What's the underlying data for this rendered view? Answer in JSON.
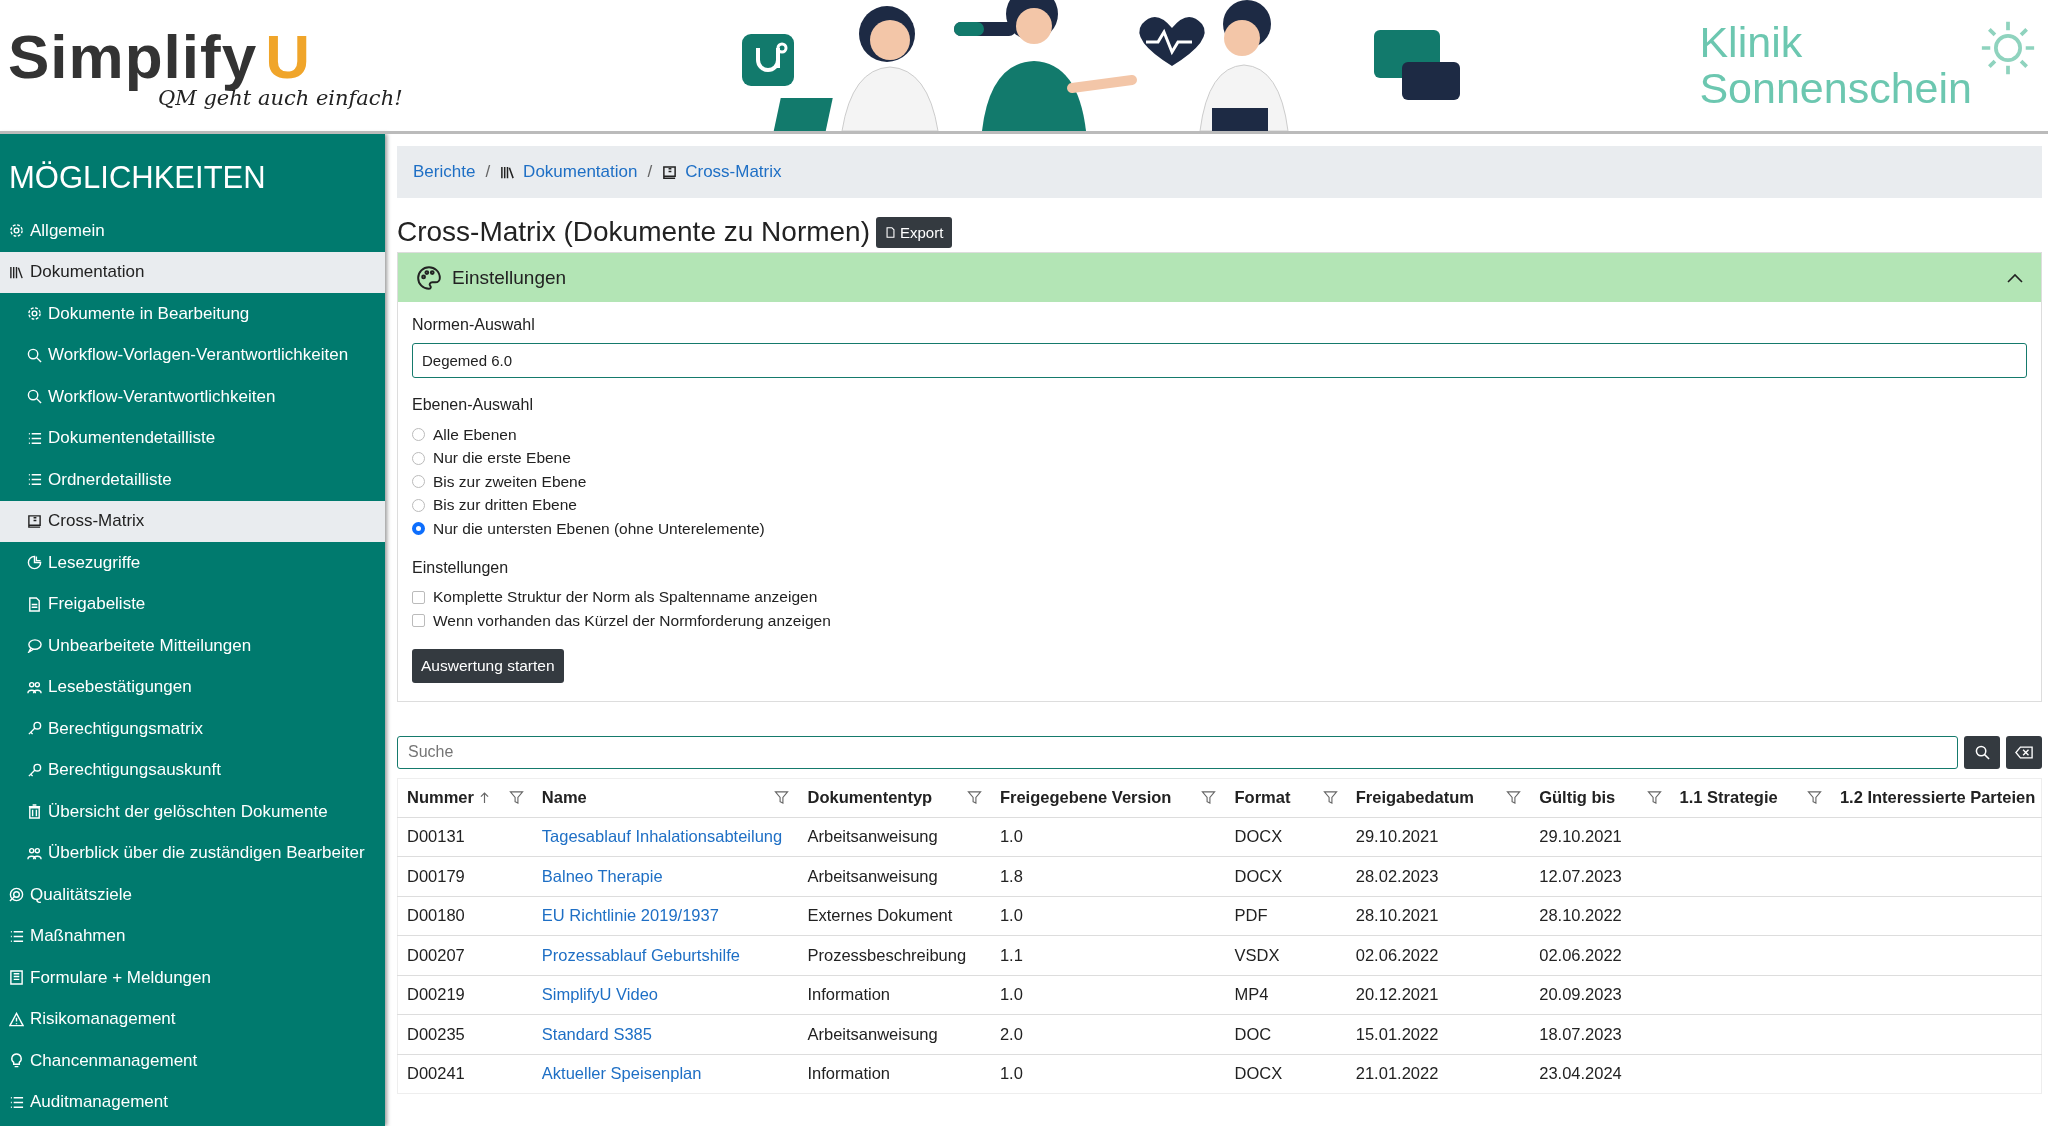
{
  "header": {
    "logo": {
      "word": "Simplify",
      "letter": "U",
      "tagline": "QM geht auch einfach!"
    },
    "clinic": {
      "line_1": "Klinik",
      "line_2": "Sonnenschein"
    }
  },
  "sidebar": {
    "title": "MÖGLICHKEITEN",
    "items": [
      {
        "label": "Allgemein",
        "selected": false
      },
      {
        "label": "Dokumentation",
        "selected": true,
        "children": [
          {
            "label": "Dokumente in Bearbeitung",
            "selected": false
          },
          {
            "label": "Workflow-Vorlagen-Verantwortlichkeiten",
            "selected": false
          },
          {
            "label": "Workflow-Verantwortlichkeiten",
            "selected": false
          },
          {
            "label": "Dokumentendetailliste",
            "selected": false
          },
          {
            "label": "Ordnerdetailliste",
            "selected": false
          },
          {
            "label": "Cross-Matrix",
            "selected": true
          },
          {
            "label": "Lesezugriffe",
            "selected": false
          },
          {
            "label": "Freigabeliste",
            "selected": false
          },
          {
            "label": "Unbearbeitete Mitteilungen",
            "selected": false
          },
          {
            "label": "Lesebestätigungen",
            "selected": false
          },
          {
            "label": "Berechtigungsmatrix",
            "selected": false
          },
          {
            "label": "Berechtigungsauskunft",
            "selected": false
          },
          {
            "label": "Übersicht der gelöschten Dokumente",
            "selected": false
          },
          {
            "label": "Überblick über die zuständigen Bearbeiter",
            "selected": false
          }
        ]
      },
      {
        "label": "Qualitätsziele",
        "selected": false
      },
      {
        "label": "Maßnahmen",
        "selected": false
      },
      {
        "label": "Formulare + Meldungen",
        "selected": false
      },
      {
        "label": "Risikomanagement",
        "selected": false
      },
      {
        "label": "Chancenmanagement",
        "selected": false
      },
      {
        "label": "Auditmanagement",
        "selected": false
      }
    ]
  },
  "breadcrumb": {
    "separator": "/",
    "items": [
      "Berichte",
      "Dokumentation",
      "Cross-Matrix"
    ]
  },
  "page": {
    "title": "Cross-Matrix (Dokumente zu Normen)",
    "export_button": "Export"
  },
  "settings": {
    "title": "Einstellungen",
    "expanded": true,
    "norm_label": "Normen-Auswahl",
    "norm_value": "Degemed 6.0",
    "level_label": "Ebenen-Auswahl",
    "levels": [
      {
        "label": "Alle Ebenen",
        "selected": false
      },
      {
        "label": "Nur die erste Ebene",
        "selected": false
      },
      {
        "label": "Bis zur zweiten Ebene",
        "selected": false
      },
      {
        "label": "Bis zur dritten Ebene",
        "selected": false
      },
      {
        "label": "Nur die untersten Ebenen (ohne Unterelemente)",
        "selected": true
      }
    ],
    "options_label": "Einstellungen",
    "options": [
      {
        "label": "Komplette Struktur der Norm als Spaltenname anzeigen",
        "checked": false
      },
      {
        "label": "Wenn vorhanden das Kürzel der Normforderung anzeigen",
        "checked": false
      }
    ],
    "start_button": "Auswertung starten"
  },
  "search": {
    "placeholder": "Suche"
  },
  "table": {
    "columns": [
      {
        "label": "Nummer",
        "sorted": true
      },
      {
        "label": "Name",
        "sorted": false
      },
      {
        "label": "Dokumententyp",
        "sorted": false
      },
      {
        "label": "Freigegebene Version",
        "sorted": false
      },
      {
        "label": "Format",
        "sorted": false
      },
      {
        "label": "Freigabedatum",
        "sorted": false
      },
      {
        "label": "Gültig bis",
        "sorted": false
      },
      {
        "label": "1.1 Strategie",
        "sorted": false
      },
      {
        "label": "1.2 Interessierte Parteien",
        "sorted": false
      }
    ],
    "rows": [
      [
        "D00131",
        "Tagesablauf Inhalationsabteilung",
        "Arbeitsanweisung",
        "1.0",
        "DOCX",
        "29.10.2021",
        "29.10.2021"
      ],
      [
        "D00179",
        "Balneo Therapie",
        "Arbeitsanweisung",
        "1.8",
        "DOCX",
        "28.02.2023",
        "12.07.2023"
      ],
      [
        "D00180",
        "EU Richtlinie 2019/1937",
        "Externes Dokument",
        "1.0",
        "PDF",
        "28.10.2021",
        "28.10.2022"
      ],
      [
        "D00207",
        "Prozessablauf Geburtshilfe",
        "Prozessbeschreibung",
        "1.1",
        "VSDX",
        "02.06.2022",
        "02.06.2022"
      ],
      [
        "D00219",
        "SimplifyU Video",
        "Information",
        "1.0",
        "MP4",
        "20.12.2021",
        "20.09.2023"
      ],
      [
        "D00235",
        "Standard S385",
        "Arbeitsanweisung",
        "2.0",
        "DOC",
        "15.01.2022",
        "18.07.2023"
      ],
      [
        "D00241",
        "Aktueller Speisenplan",
        "Information",
        "1.0",
        "DOCX",
        "21.01.2022",
        "23.04.2024"
      ]
    ]
  }
}
